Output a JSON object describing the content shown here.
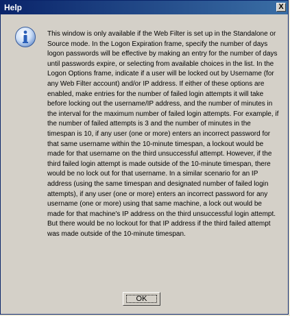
{
  "window": {
    "title": "Help",
    "close_label": "X"
  },
  "icon": {
    "name": "info-icon",
    "color": "#2a5fb8"
  },
  "message": {
    "text": "This window is only available if the Web Filter is set up in the Standalone or Source mode. In the Logon Expiration frame, specify the number of days logon passwords will be effective by making an entry for the number of days until passwords expire, or selecting from available choices in the list. In the Logon Options frame, indicate if a user will be locked out by Username (for any Web Filter account) and/or IP address. If either of these options are enabled, make entries for the number of failed login attempts it will take before locking out the username/IP address, and the number of minutes in the interval for the maximum number of failed login attempts. For example, if the number of failed attempts is 3 and the number of minutes in the timespan is 10, if any user (one or more) enters an incorrect password for that same username within the 10-minute timespan, a lockout would be made for that username on the third unsuccessful attempt. However, if the third failed login attempt is made outside of the 10-minute timespan, there would be no lock out for that username. In a similar scenario for an IP address (using the same timespan and designated number of failed login attempts), if any user (one or more) enters an incorrect password for any username (one or more) using that same machine, a lock out would be made for that machine's IP address on the third unsuccessful login attempt. But there would be no lockout for that IP address if the third failed attempt was made outside of the 10-minute timespan."
  },
  "buttons": {
    "ok_label": "OK"
  }
}
